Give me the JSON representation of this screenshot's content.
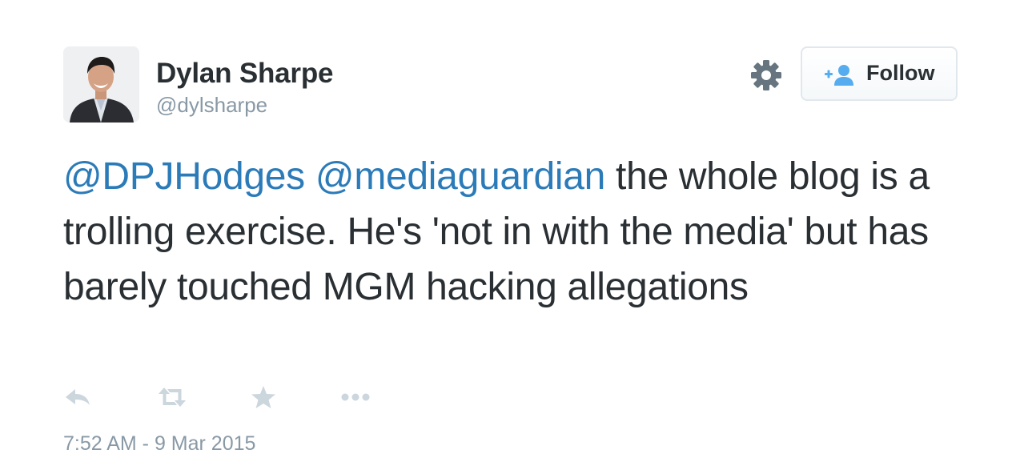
{
  "user": {
    "full_name": "Dylan Sharpe",
    "screen_name": "@dylsharpe"
  },
  "header": {
    "follow_label": "Follow"
  },
  "tweet": {
    "mention_1": "@DPJHodges",
    "mention_2": "@mediaguardian",
    "body": " the whole blog is a trolling exercise. He's 'not in with the media' but has barely touched MGM hacking allegations",
    "timestamp": "7:52 AM - 9 Mar 2015"
  },
  "icons": {
    "settings": "gear-icon",
    "follow": "add-user-icon",
    "reply": "reply-icon",
    "retweet": "retweet-icon",
    "favorite": "star-icon",
    "more": "more-icon"
  },
  "colors": {
    "text": "#292f33",
    "link": "#2b7bb9",
    "muted": "#8899a6",
    "icon": "#ccd6dd",
    "follow_icon": "#55acee"
  }
}
